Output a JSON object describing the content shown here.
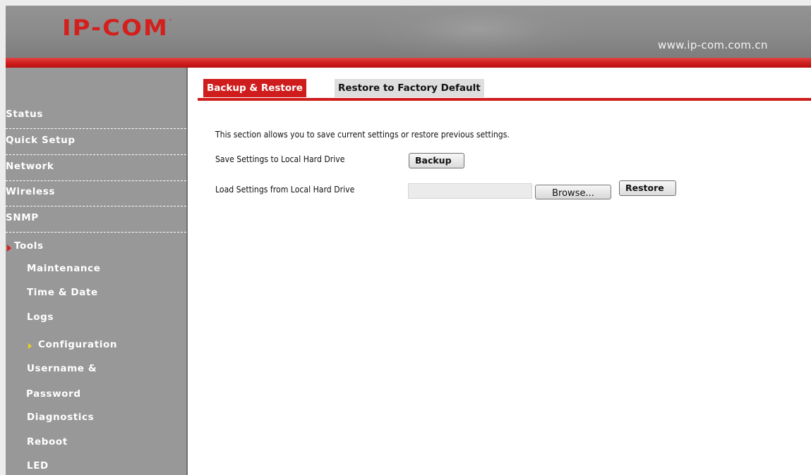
{
  "header": {
    "logo_text": "IP-COM",
    "logo_mark": ".",
    "site_url": "www.ip-com.com.cn"
  },
  "sidebar": {
    "items": [
      {
        "label": "Status"
      },
      {
        "label": "Quick Setup"
      },
      {
        "label": "Network"
      },
      {
        "label": "Wireless"
      },
      {
        "label": "SNMP"
      },
      {
        "label": "Tools"
      }
    ],
    "tools_submenu": [
      {
        "label": "Maintenance"
      },
      {
        "label": "Time & Date"
      },
      {
        "label": "Logs"
      },
      {
        "label": "Configuration"
      },
      {
        "label": "Username &"
      },
      {
        "label": "Password"
      },
      {
        "label": "Diagnostics"
      },
      {
        "label": "Reboot"
      },
      {
        "label": "LED"
      }
    ],
    "active_item": "Tools",
    "active_subitem": "Configuration"
  },
  "tabs": [
    {
      "label": "Backup & Restore",
      "active": true
    },
    {
      "label": "Restore to Factory Default",
      "active": false
    }
  ],
  "content": {
    "description": "This section allows you to save current settings or restore previous settings.",
    "save_label": "Save Settings to Local Hard Drive",
    "backup_button": "Backup",
    "load_label": "Load Settings from Local Hard Drive",
    "file_input_value": "",
    "browse_button": "Browse...",
    "restore_button": "Restore"
  },
  "colors": {
    "brand_red": "#cf1d1d",
    "sidebar_bg": "#989898",
    "header_bg": "#8a8a8a",
    "active_marker": "#e01c1c",
    "sub_marker": "#f2d21a"
  }
}
